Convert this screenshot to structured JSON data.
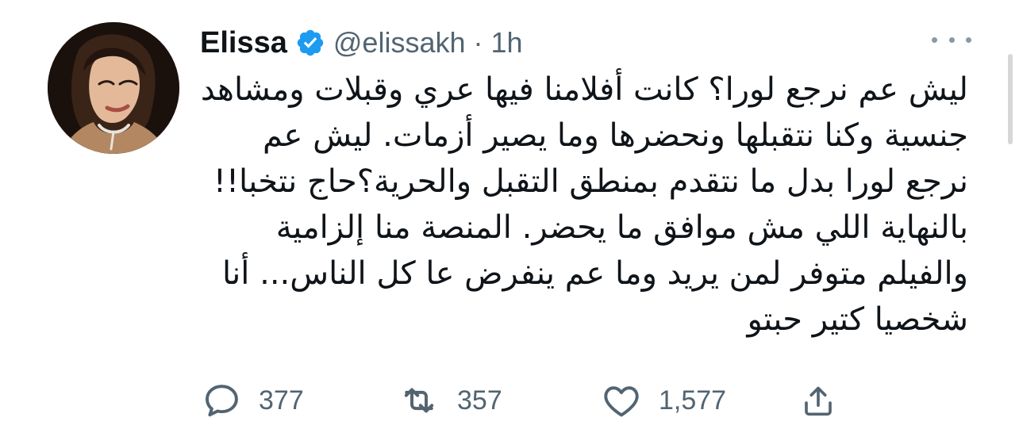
{
  "tweet": {
    "author": {
      "display_name": "Elissa",
      "handle": "@elissakh",
      "verified_icon": "verified-badge-icon",
      "avatar_icon": "avatar-image"
    },
    "meta": {
      "separator": "·",
      "time": "1h"
    },
    "text": "ليش عم نرجع لورا؟ كانت أفلامنا فيها عري وقبلات ومشاهد جنسية وكنا نتقبلها ونحضرها وما يصير أزمات. ليش عم نرجع لورا بدل ما نتقدم بمنطق التقبل والحرية؟حاج نتخبا!! بالنهاية اللي مش موافق ما يحضر. المنصة منا إلزامية والفيلم متوفر لمن يريد وما عم ينفرض عا كل الناس... أنا شخصيا كتير حبتو",
    "actions": {
      "reply_count": "377",
      "retweet_count": "357",
      "like_count": "1,577"
    }
  },
  "icons": {
    "more": "more-options-icon",
    "reply": "reply-icon",
    "retweet": "retweet-icon",
    "like": "heart-icon",
    "share": "share-icon"
  },
  "colors": {
    "text_primary": "#0f1419",
    "text_secondary": "#536471",
    "verified": "#1d9bf0",
    "background": "#ffffff"
  }
}
